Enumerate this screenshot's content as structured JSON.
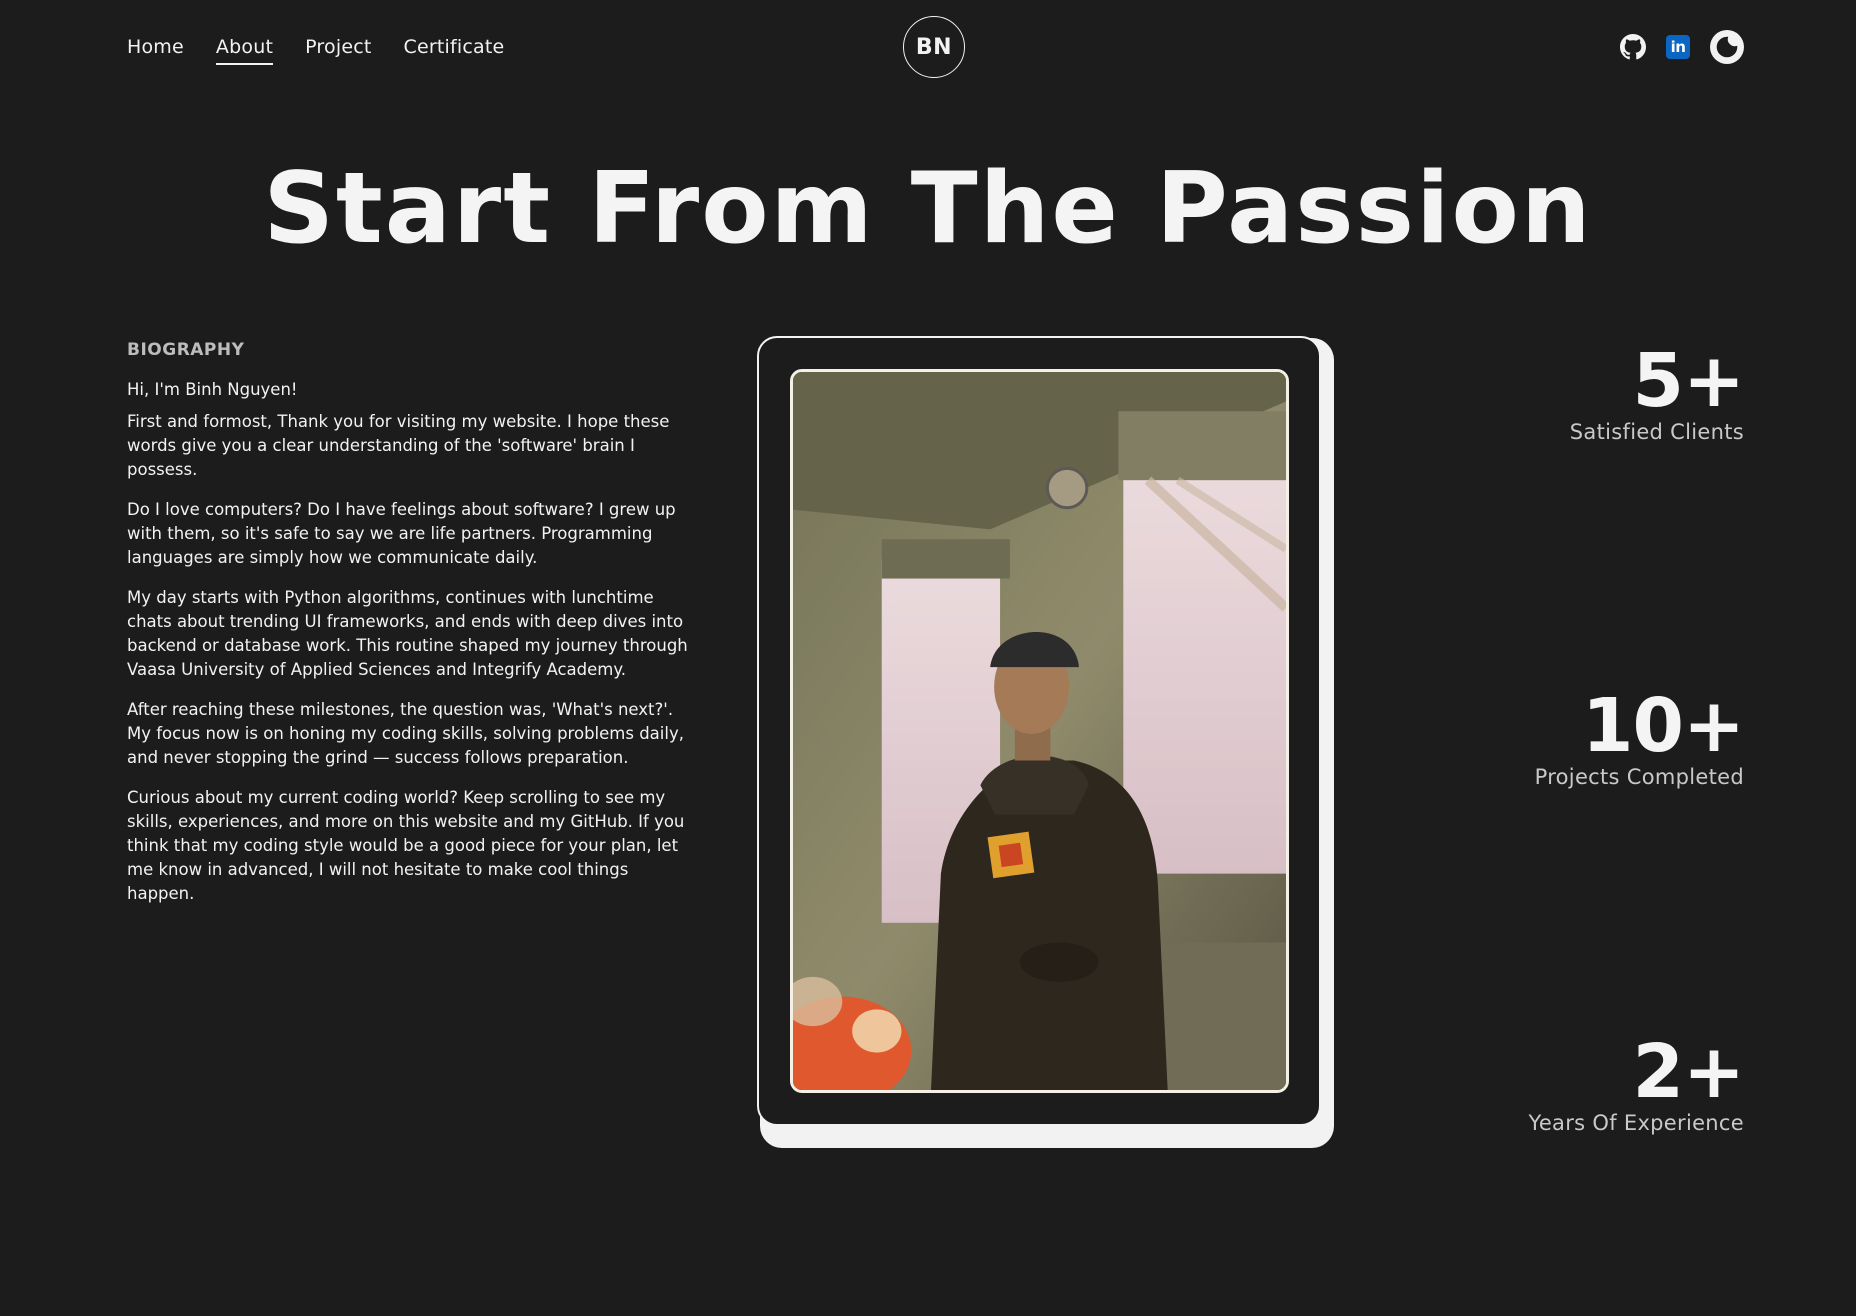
{
  "nav": {
    "links": [
      "Home",
      "About",
      "Project",
      "Certificate"
    ],
    "active": "About"
  },
  "logo": "BN",
  "socials": {
    "github_icon": "github-icon",
    "linkedin_icon": "linkedin-icon",
    "linkedin_text": "in",
    "theme_icon": "moon-icon"
  },
  "hero": {
    "title": "Start From The Passion"
  },
  "biography": {
    "heading": "BIOGRAPHY",
    "greeting": "Hi, I'm Binh Nguyen!",
    "paragraphs": [
      "First and formost, Thank you for visiting my website. I hope these words give you a clear understanding of the 'software' brain I possess.",
      "Do I love computers? Do I have feelings about software? I grew up with them, so it's safe to say we are life partners. Programming languages are simply how we communicate daily.",
      "My day starts with Python algorithms, continues with lunchtime chats about trending UI frameworks, and ends with deep dives into backend or database work. This routine shaped my journey through Vaasa University of Applied Sciences and Integrify Academy.",
      "After reaching these milestones, the question was, 'What's next?'. My focus now is on honing my coding skills, solving problems daily, and never stopping the grind — success follows preparation.",
      "Curious about my current coding world? Keep scrolling to see my skills, experiences, and more on this website and my GitHub. If you think that my coding style would be a good piece for your plan, let me know in advanced, I will not hesitate to make cool things happen."
    ]
  },
  "stats": [
    {
      "value": "5+",
      "label": "Satisfied Clients"
    },
    {
      "value": "10+",
      "label": "Projects Completed"
    },
    {
      "value": "2+",
      "label": "Years Of Experience"
    }
  ],
  "colors": {
    "background": "#1c1c1c",
    "text": "#f2f2f2",
    "muted": "#c9c9c9",
    "linkedin": "#0a66c2"
  }
}
